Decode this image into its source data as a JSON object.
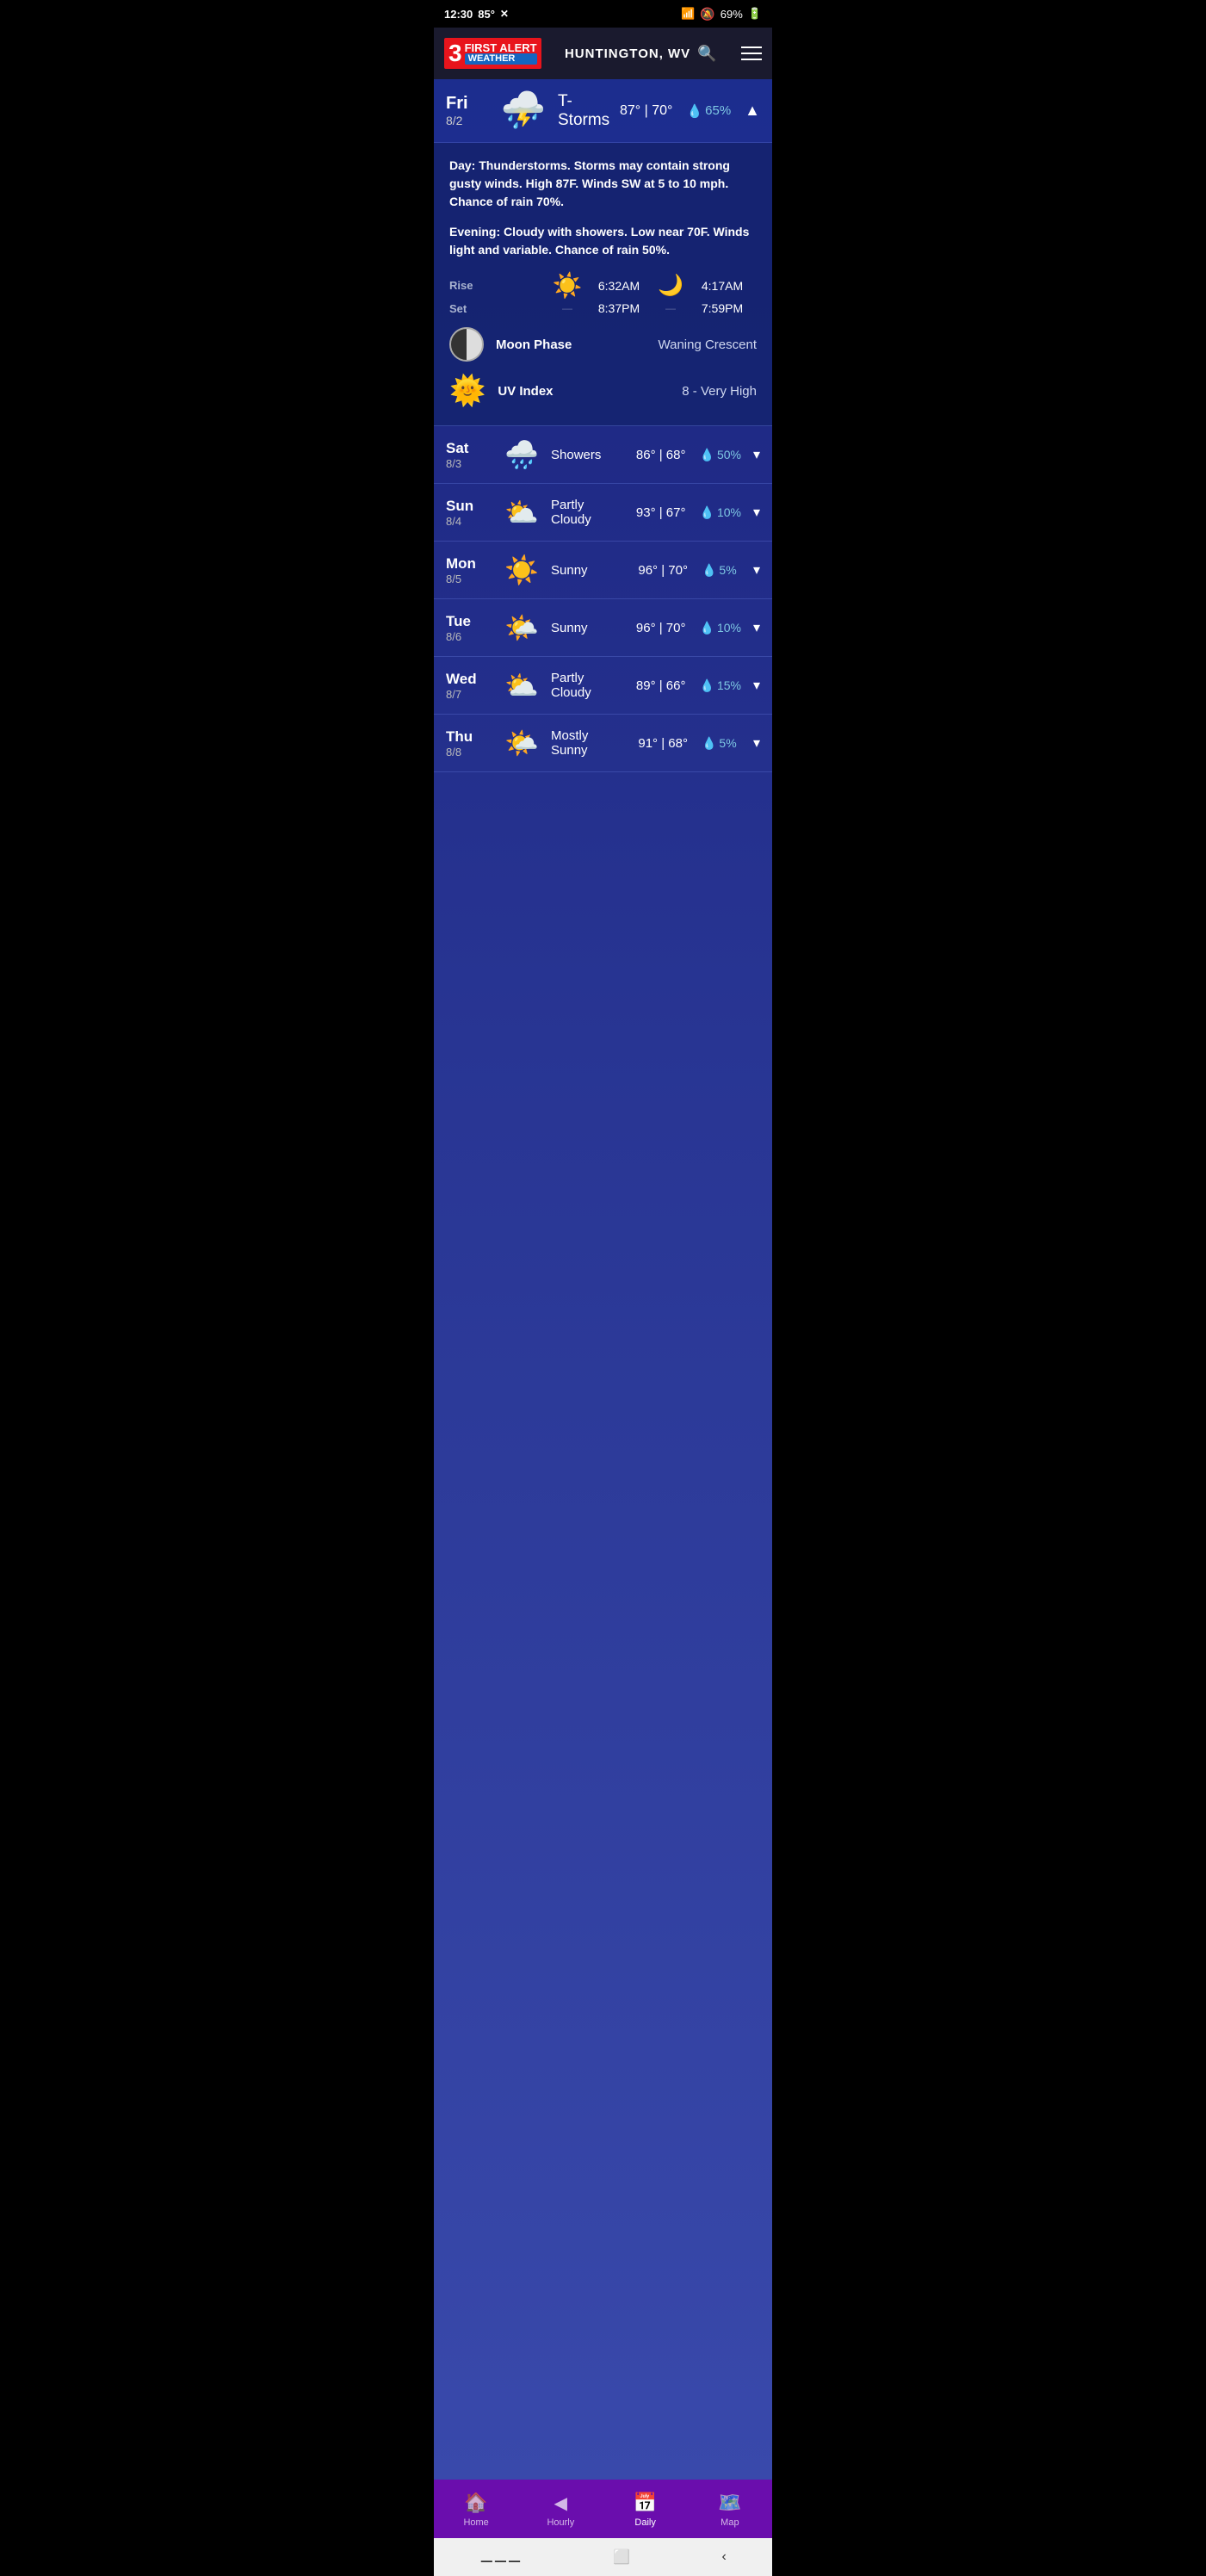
{
  "statusBar": {
    "time": "12:30",
    "temp": "85°",
    "wifi": "wifi",
    "battery": "69%"
  },
  "header": {
    "logoNum": "3",
    "firstAlert": "FIRST ALERT",
    "weatherBadge": "WEATHER",
    "location": "HUNTINGTON, WV",
    "menuLabel": "menu"
  },
  "todayForecast": {
    "dayName": "Fri",
    "dayDate": "8/2",
    "condition": "T-Storms",
    "tempHigh": "87°",
    "tempLow": "70°",
    "precipPct": "65%",
    "dayDetail": "Thunderstorms. Storms may contain strong gusty winds. High 87F. Winds SW at 5 to 10 mph. Chance of rain 70%.",
    "eveningDetail": "Cloudy with showers. Low near 70F. Winds light and variable. Chance of rain 50%.",
    "sunRise": "6:32AM",
    "sunSet": "8:37PM",
    "moonRise": "4:17AM",
    "moonSet": "7:59PM",
    "moonPhase": "Waning Crescent",
    "uvIndex": "8 - Very High",
    "sunriseLabel": "Rise",
    "sunsetLabel": "Set",
    "moonPhaseLabel": "Moon Phase",
    "uvIndexLabel": "UV Index",
    "dayPrefix": "Day:",
    "eveningPrefix": "Evening:"
  },
  "forecast": [
    {
      "dayName": "Sat",
      "dayDate": "8/3",
      "condition": "Showers",
      "tempHigh": "86°",
      "tempLow": "68°",
      "precipPct": "50%",
      "icon": "🌧️"
    },
    {
      "dayName": "Sun",
      "dayDate": "8/4",
      "condition": "Partly\nCloudy",
      "tempHigh": "93°",
      "tempLow": "67°",
      "precipPct": "10%",
      "icon": "⛅"
    },
    {
      "dayName": "Mon",
      "dayDate": "8/5",
      "condition": "Sunny",
      "tempHigh": "96°",
      "tempLow": "70°",
      "precipPct": "5%",
      "icon": "☀️"
    },
    {
      "dayName": "Tue",
      "dayDate": "8/6",
      "condition": "Sunny",
      "tempHigh": "96°",
      "tempLow": "70°",
      "precipPct": "10%",
      "icon": "🌤️"
    },
    {
      "dayName": "Wed",
      "dayDate": "8/7",
      "condition": "Partly\nCloudy",
      "tempHigh": "89°",
      "tempLow": "66°",
      "precipPct": "15%",
      "icon": "⛅"
    },
    {
      "dayName": "Thu",
      "dayDate": "8/8",
      "condition": "Mostly\nSunny",
      "tempHigh": "91°",
      "tempLow": "68°",
      "precipPct": "5%",
      "icon": "🌤️"
    }
  ],
  "bottomNav": {
    "items": [
      {
        "label": "Home",
        "icon": "🏠",
        "active": false
      },
      {
        "label": "Hourly",
        "icon": "◀",
        "active": false
      },
      {
        "label": "Daily",
        "icon": "📅",
        "active": true
      },
      {
        "label": "Map",
        "icon": "🗺️",
        "active": false
      }
    ]
  }
}
